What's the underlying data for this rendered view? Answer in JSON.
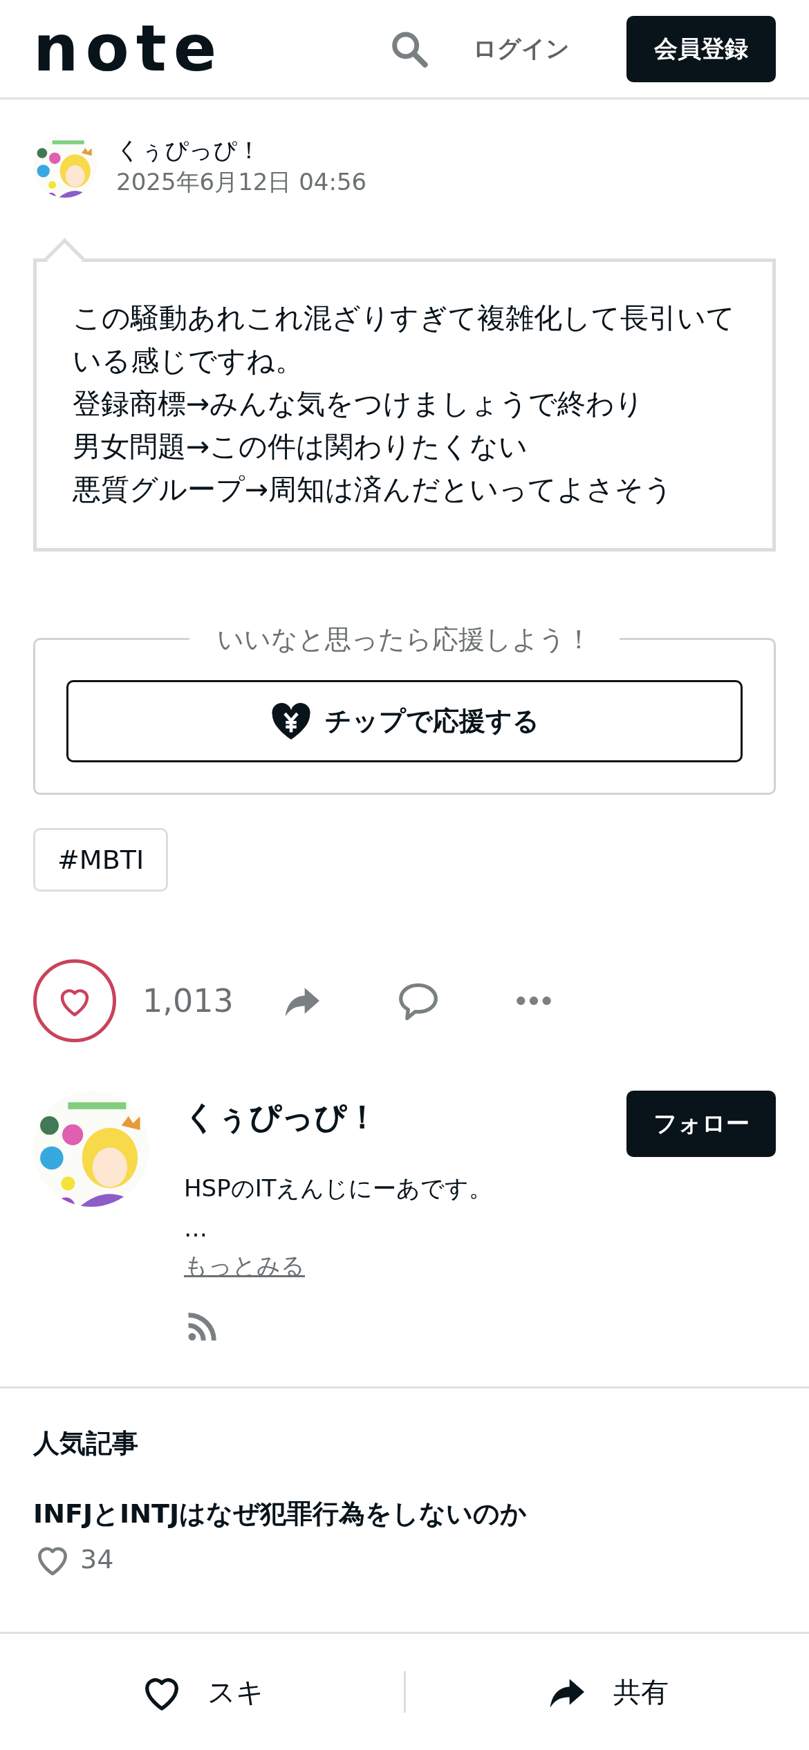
{
  "header": {
    "logo": "note",
    "login": "ログイン",
    "signup": "会員登録"
  },
  "post": {
    "author": "くぅぴっぴ！",
    "date": "2025年6月12日 04:56",
    "paragraphs": [
      "この騒動あれこれ混ざりすぎて複雑化して長引いている感じですね。",
      "登録商標→みんな気をつけましょうで終わり",
      "男女問題→この件は関わりたくない",
      "悪質グループ→周知は済んだといってよさそう"
    ]
  },
  "tip": {
    "legend": "いいなと思ったら応援しよう！",
    "button": "チップで応援する"
  },
  "tags": [
    "#MBTI"
  ],
  "actions": {
    "like_count": "1,013"
  },
  "profile": {
    "name": "くぅぴっぴ！",
    "follow": "フォロー",
    "bio": "HSPのITえんじにーあです。",
    "ellipsis": "…",
    "more": "もっとみる"
  },
  "popular": {
    "heading": "人気記事",
    "articles": [
      {
        "title": "INFJとINTJはなぜ犯罪行為をしないのか",
        "likes": "34"
      }
    ]
  },
  "bottom_bar": {
    "like": "スキ",
    "share": "共有"
  }
}
